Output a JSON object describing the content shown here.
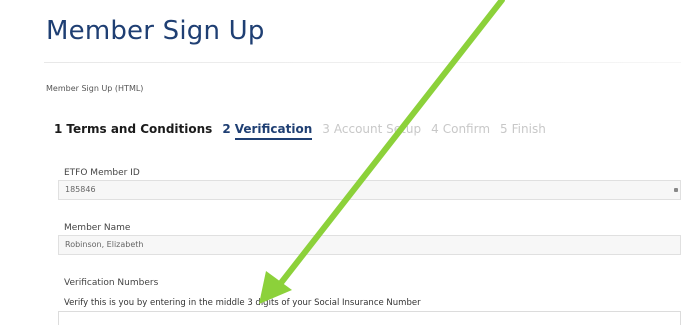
{
  "page": {
    "title": "Member Sign Up",
    "breadcrumb": "Member Sign Up (HTML)"
  },
  "steps": [
    {
      "num": "1",
      "label": "Terms and Conditions",
      "state": "done"
    },
    {
      "num": "2",
      "label": "Verification",
      "state": "active"
    },
    {
      "num": "3",
      "label": "Account Setup",
      "state": "pending"
    },
    {
      "num": "4",
      "label": "Confirm",
      "state": "pending"
    },
    {
      "num": "5",
      "label": "Finish",
      "state": "pending"
    }
  ],
  "form": {
    "member_id": {
      "label": "ETFO Member ID",
      "value": "185846"
    },
    "member_name": {
      "label": "Member Name",
      "value": "Robinson, Elizabeth"
    },
    "verification": {
      "label": "Verification Numbers",
      "helper": "Verify this is you by entering in the middle 3 digits of your Social Insurance Number",
      "value": ""
    }
  },
  "annotation": {
    "color": "#8cd13a",
    "icon": "arrow-icon"
  },
  "colors": {
    "accent": "#1f3f73",
    "pending": "#c8c8c8"
  }
}
